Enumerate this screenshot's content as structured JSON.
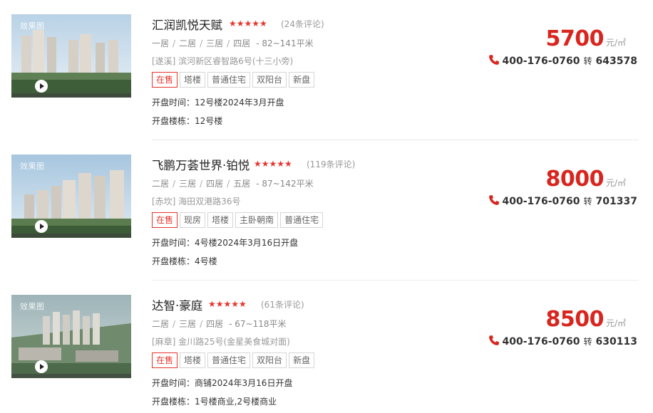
{
  "listings": [
    {
      "image_tag": "效果图",
      "name": "汇润凯悦天赋",
      "stars": "★★★★★",
      "reviews": "(24条评论)",
      "rooms": [
        "一居",
        "二居",
        "三居",
        "四居"
      ],
      "separator": "/",
      "area": "- 82~141平米",
      "address": "[遂溪] 滨河新区睿智路6号(十三小旁)",
      "status_tag": "在售",
      "tags": [
        "塔楼",
        "普通住宅",
        "双阳台",
        "新盘"
      ],
      "open_time": "开盘时间：12号楼2024年3月开盘",
      "open_buildings": "开盘楼栋：12号楼",
      "price": "5700",
      "price_unit": "元/㎡",
      "phone": "400-176-0760",
      "ext_label": "转",
      "ext": "643578"
    },
    {
      "image_tag": "效果图",
      "name": "飞鹏万荟世界·铂悦",
      "stars": "★★★★★",
      "reviews": "(119条评论)",
      "rooms": [
        "二居",
        "三居",
        "四居",
        "五居"
      ],
      "separator": "/",
      "area": "- 87~142平米",
      "address": "[赤坎] 海田双港路36号",
      "status_tag": "在售",
      "tags": [
        "现房",
        "塔楼",
        "主卧朝南",
        "普通住宅"
      ],
      "open_time": "开盘时间：4号楼2024年3月16日开盘",
      "open_buildings": "开盘楼栋：4号楼",
      "price": "8000",
      "price_unit": "元/㎡",
      "phone": "400-176-0760",
      "ext_label": "转",
      "ext": "701337"
    },
    {
      "image_tag": "效果图",
      "name": "达智·豪庭",
      "stars": "★★★★★",
      "reviews": "(61条评论)",
      "rooms": [
        "二居",
        "三居",
        "四居"
      ],
      "separator": "/",
      "area": "- 67~118平米",
      "address": "[麻章] 金川路25号(金星美食城对面)",
      "status_tag": "在售",
      "tags": [
        "塔楼",
        "普通住宅",
        "双阳台",
        "新盘"
      ],
      "open_time": "开盘时间：商铺2024年3月16日开盘",
      "open_buildings": "开盘楼栋：1号楼商业,2号楼商业",
      "price": "8500",
      "price_unit": "元/㎡",
      "phone": "400-176-0760",
      "ext_label": "转",
      "ext": "630113"
    }
  ],
  "colors": {
    "accent_red": "#d8261f",
    "star_red": "#e8342c",
    "muted": "#999999"
  },
  "icons": {
    "play": "play-icon",
    "phone": "phone-icon",
    "star": "star-icon"
  }
}
